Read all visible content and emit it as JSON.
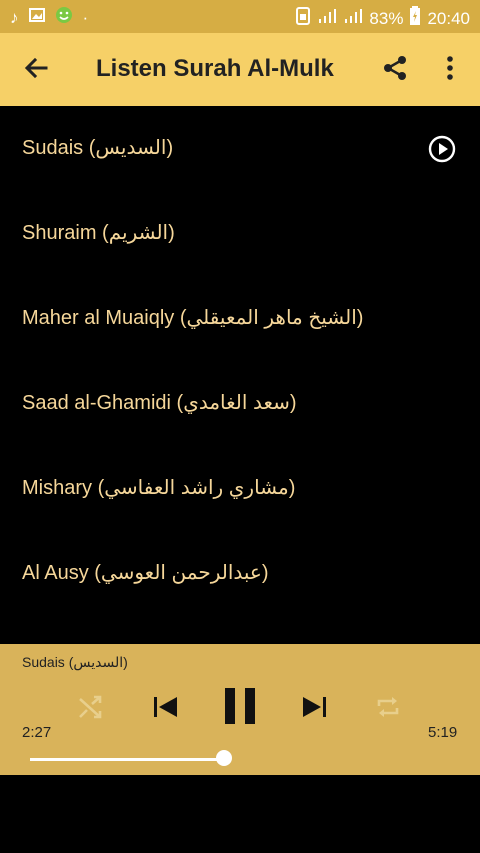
{
  "status": {
    "battery": "83%",
    "time": "20:40"
  },
  "appbar": {
    "title": "Listen Surah Al-Mulk"
  },
  "reciters": [
    {
      "label": "Sudais (السديس)"
    },
    {
      "label": "Shuraim (الشريم)"
    },
    {
      "label": "Maher al Muaiqly (الشيخ ماهر المعيقلي)"
    },
    {
      "label": "Saad al-Ghamidi (سعد الغامدي)"
    },
    {
      "label": "Mishary (مشاري راشد العفاسي)"
    },
    {
      "label": "Al Ausy (عبدالرحمن العوسي)"
    }
  ],
  "player": {
    "now_playing": "Sudais (السديس)",
    "elapsed": "2:27",
    "duration": "5:19",
    "progress": 0.46
  },
  "colors": {
    "statusbar": "#d6ad44",
    "appbar": "#f6d067",
    "list_text": "#f6d79a",
    "player": "#d9b35a"
  }
}
